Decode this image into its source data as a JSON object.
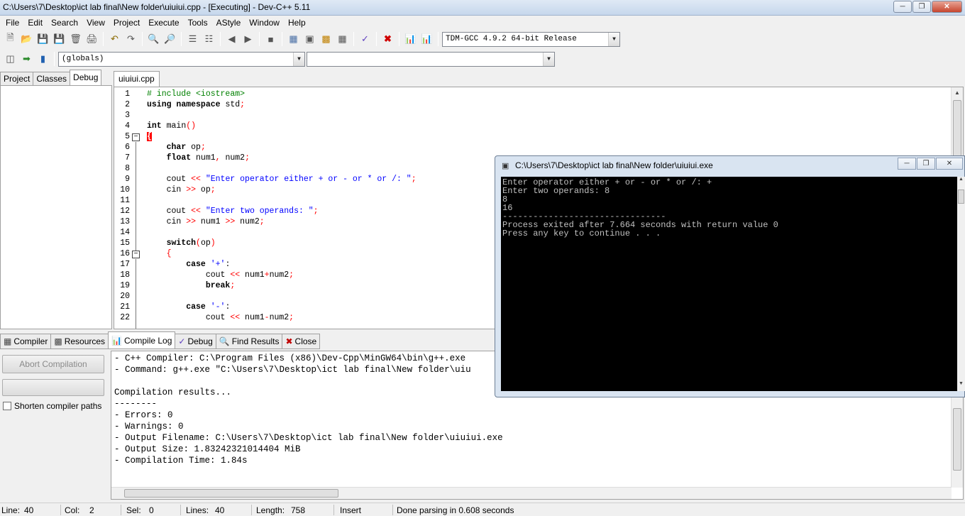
{
  "window": {
    "title": "C:\\Users\\7\\Desktop\\ict lab final\\New folder\\uiuiui.cpp - [Executing] - Dev-C++ 5.11"
  },
  "menu": [
    "File",
    "Edit",
    "Search",
    "View",
    "Project",
    "Execute",
    "Tools",
    "AStyle",
    "Window",
    "Help"
  ],
  "toolbar": {
    "compiler": "TDM-GCC 4.9.2 64-bit Release",
    "scope": "(globals)",
    "member": ""
  },
  "left_tabs": [
    "Project",
    "Classes",
    "Debug"
  ],
  "editor_tab": "uiuiui.cpp",
  "code_lines": [
    {
      "n": "1",
      "t": "# include <iostream>"
    },
    {
      "n": "2",
      "t": "using namespace std;"
    },
    {
      "n": "3",
      "t": ""
    },
    {
      "n": "4",
      "t": "int main()"
    },
    {
      "n": "5",
      "t": "{"
    },
    {
      "n": "6",
      "t": "    char op;"
    },
    {
      "n": "7",
      "t": "    float num1, num2;"
    },
    {
      "n": "8",
      "t": ""
    },
    {
      "n": "9",
      "t": "    cout << \"Enter operator either + or - or * or /: \";"
    },
    {
      "n": "10",
      "t": "    cin >> op;"
    },
    {
      "n": "11",
      "t": ""
    },
    {
      "n": "12",
      "t": "    cout << \"Enter two operands: \";"
    },
    {
      "n": "13",
      "t": "    cin >> num1 >> num2;"
    },
    {
      "n": "14",
      "t": ""
    },
    {
      "n": "15",
      "t": "    switch(op)"
    },
    {
      "n": "16",
      "t": "    {"
    },
    {
      "n": "17",
      "t": "        case '+':"
    },
    {
      "n": "18",
      "t": "            cout << num1+num2;"
    },
    {
      "n": "19",
      "t": "            break;"
    },
    {
      "n": "20",
      "t": ""
    },
    {
      "n": "21",
      "t": "        case '-':"
    },
    {
      "n": "22",
      "t": "            cout << num1-num2;"
    }
  ],
  "bottom_tabs": [
    "Compiler",
    "Resources",
    "Compile Log",
    "Debug",
    "Find Results",
    "Close"
  ],
  "bottom_left": {
    "abort": "Abort Compilation",
    "shorten": "Shorten compiler paths"
  },
  "log_lines": [
    "- C++ Compiler: C:\\Program Files (x86)\\Dev-Cpp\\MinGW64\\bin\\g++.exe",
    "- Command: g++.exe \"C:\\Users\\7\\Desktop\\ict lab final\\New folder\\uiu",
    "",
    "Compilation results...",
    "--------",
    "- Errors: 0",
    "- Warnings: 0",
    "- Output Filename: C:\\Users\\7\\Desktop\\ict lab final\\New folder\\uiuiui.exe",
    "- Output Size: 1.83242321014404 MiB",
    "- Compilation Time: 1.84s"
  ],
  "status": {
    "line_label": "Line:",
    "line": "40",
    "col_label": "Col:",
    "col": "2",
    "sel_label": "Sel:",
    "sel": "0",
    "lines_label": "Lines:",
    "lines": "40",
    "length_label": "Length:",
    "length": "758",
    "mode": "Insert",
    "message": "Done parsing in 0.608 seconds"
  },
  "console": {
    "title": "C:\\Users\\7\\Desktop\\ict lab final\\New folder\\uiuiui.exe",
    "lines": [
      "Enter operator either + or - or * or /: +",
      "Enter two operands: 8",
      "8",
      "16",
      "--------------------------------",
      "Process exited after 7.664 seconds with return value 0",
      "Press any key to continue . . ."
    ]
  }
}
